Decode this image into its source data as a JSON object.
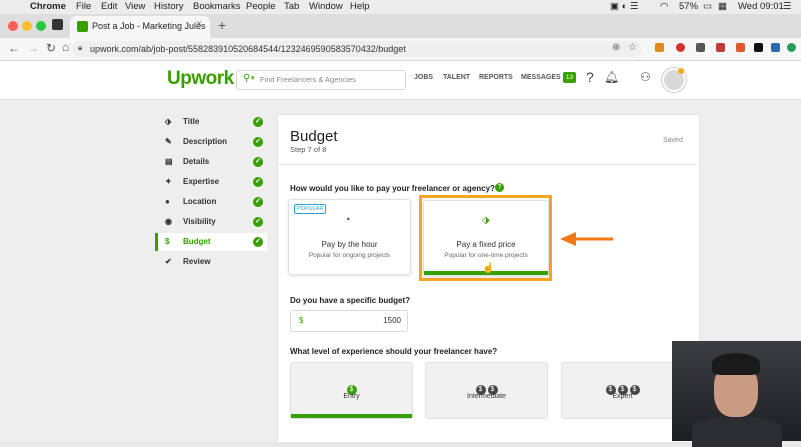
{
  "menubar": {
    "app": "Chrome",
    "items": [
      "File",
      "Edit",
      "View",
      "History",
      "Bookmarks",
      "People",
      "Tab",
      "Window",
      "Help"
    ],
    "battery": "57%",
    "clock": "Wed 09:01"
  },
  "browser": {
    "tab_title": "Post a Job - Marketing Jules",
    "url": "upwork.com/ab/job-post/558283910520684544/1232469590583570432/budget"
  },
  "upwork": {
    "logo": "Upwork",
    "search_placeholder": "Find Freelancers & Agencies",
    "nav": [
      "JOBS",
      "TALENT",
      "REPORTS",
      "MESSAGES"
    ],
    "messages_badge": "13"
  },
  "sidebar": {
    "items": [
      {
        "label": "Title",
        "icon": "tag-icon",
        "done": true
      },
      {
        "label": "Description",
        "icon": "edit-icon",
        "done": true
      },
      {
        "label": "Details",
        "icon": "document-icon",
        "done": true
      },
      {
        "label": "Expertise",
        "icon": "puzzle-icon",
        "done": true
      },
      {
        "label": "Location",
        "icon": "map-pin-icon",
        "done": true
      },
      {
        "label": "Visibility",
        "icon": "eye-icon",
        "done": true
      },
      {
        "label": "Budget",
        "icon": "dollar-icon",
        "done": true,
        "active": true
      },
      {
        "label": "Review",
        "icon": "checkmark-icon",
        "done": false
      }
    ]
  },
  "page": {
    "title": "Budget",
    "step": "Step 7 of 8",
    "saved": "Saved",
    "pay_question": "How would you like to pay your freelancer or agency?",
    "options": [
      {
        "badge": "POPULAR",
        "title": "Pay by the hour",
        "subtitle": "Popular for ongoing projects"
      },
      {
        "title": "Pay a fixed price",
        "subtitle": "Popular for one-time projects"
      }
    ],
    "budget_question": "Do you have a specific budget?",
    "budget_currency": "$",
    "budget_value": "1500",
    "experience_question": "What level of experience should your freelancer have?",
    "experience": [
      {
        "label": "Entry",
        "coins": "$"
      },
      {
        "label": "Intermediate",
        "coins": "$$"
      },
      {
        "label": "Expert",
        "coins": "$$$"
      }
    ]
  },
  "colors": {
    "accent": "#37a000",
    "highlight": "#f5a623",
    "arrow": "#f07a16",
    "popular_badge": "#2aa3d8"
  }
}
